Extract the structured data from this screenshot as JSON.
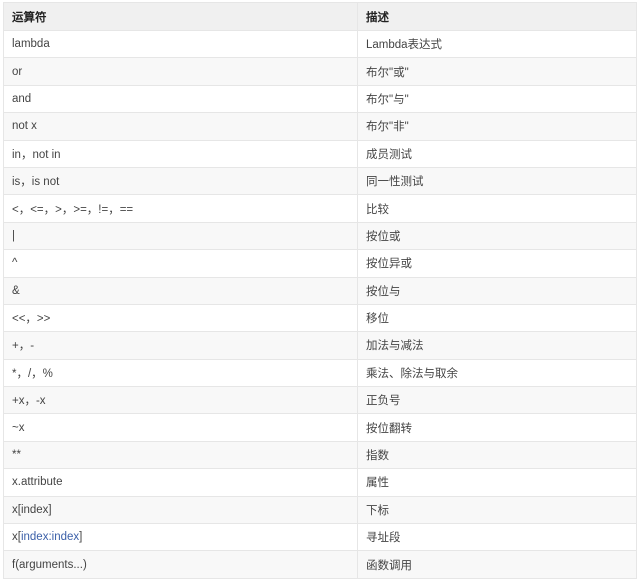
{
  "table": {
    "headers": [
      "运算符",
      "描述"
    ],
    "rows": [
      {
        "op": "lambda",
        "desc": "Lambda表达式"
      },
      {
        "op": "or",
        "desc": "布尔\"或\""
      },
      {
        "op": "and",
        "desc": "布尔\"与\""
      },
      {
        "op": "not x",
        "desc": "布尔\"非\""
      },
      {
        "op": "in，not in",
        "desc": "成员测试"
      },
      {
        "op": "is，is not",
        "desc": "同一性测试"
      },
      {
        "op": "<，<=，>，>=，!=，==",
        "desc": "比较"
      },
      {
        "op": "|",
        "desc": "按位或"
      },
      {
        "op": "^",
        "desc": "按位异或"
      },
      {
        "op": "&",
        "desc": "按位与"
      },
      {
        "op": "<<，>>",
        "desc": "移位"
      },
      {
        "op": "+，-",
        "desc": " 加法与减法"
      },
      {
        "op": "*，/，%",
        "desc": "乘法、除法与取余"
      },
      {
        "op": "+x，-x",
        "desc": "正负号"
      },
      {
        "op": "~x",
        "desc": "按位翻转"
      },
      {
        "op": "**",
        "desc": "指数"
      },
      {
        "op": "x.attribute",
        "desc": "属性"
      },
      {
        "op": "x[index]",
        "desc": "下标"
      },
      {
        "op_prefix": "x[",
        "op_link": "index:index",
        "op_suffix": "]",
        "desc": "寻址段"
      },
      {
        "op": "f(arguments...)",
        "desc": "函数调用"
      }
    ]
  }
}
